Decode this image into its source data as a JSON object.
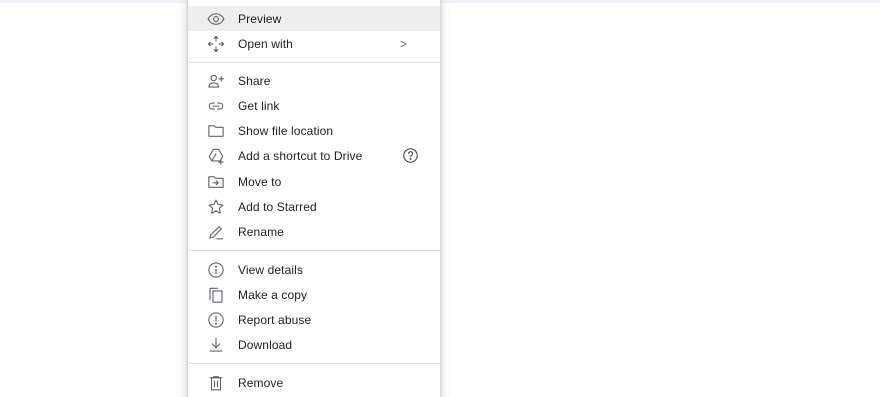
{
  "menu": {
    "items": [
      {
        "label": "Preview",
        "icon": "eye-icon"
      },
      {
        "label": "Open with",
        "icon": "open-with-icon",
        "submenu_indicator": ">"
      },
      {
        "label": "Share",
        "icon": "add-person-icon"
      },
      {
        "label": "Get link",
        "icon": "link-icon"
      },
      {
        "label": "Show file location",
        "icon": "folder-icon"
      },
      {
        "label": "Add a shortcut to Drive",
        "icon": "drive-shortcut-icon",
        "help_icon": "help-circle-icon"
      },
      {
        "label": "Move to",
        "icon": "move-to-folder-icon"
      },
      {
        "label": "Add to Starred",
        "icon": "star-icon"
      },
      {
        "label": "Rename",
        "icon": "pencil-icon"
      },
      {
        "label": "View details",
        "icon": "info-icon"
      },
      {
        "label": "Make a copy",
        "icon": "copy-icon"
      },
      {
        "label": "Report abuse",
        "icon": "report-icon"
      },
      {
        "label": "Download",
        "icon": "download-icon"
      },
      {
        "label": "Remove",
        "icon": "trash-icon"
      }
    ],
    "hovered_item": "Preview"
  },
  "colors": {
    "icon": "#5f6368",
    "text": "#202124",
    "hover_bg": "#eeeeee",
    "divider": "#e0e0e0",
    "top_bar": "#eef2f8"
  }
}
